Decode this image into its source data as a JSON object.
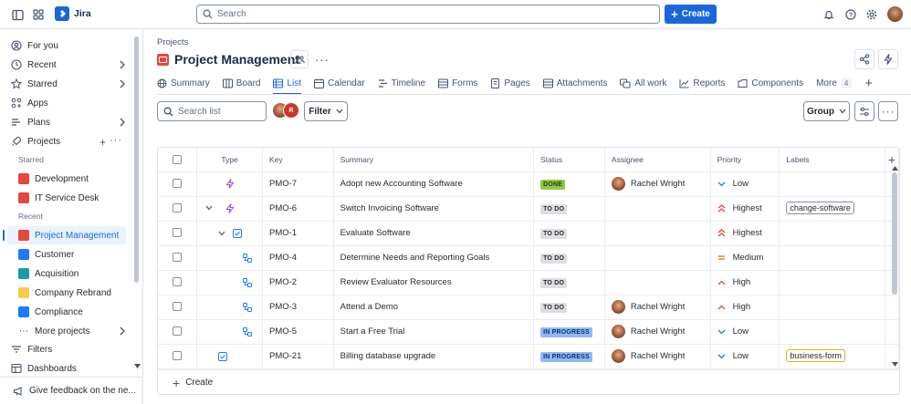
{
  "topbar": {
    "app_name": "Jira",
    "search_placeholder": "Search",
    "create_label": "Create"
  },
  "sidebar": {
    "nav": [
      {
        "label": "For you"
      },
      {
        "label": "Recent"
      },
      {
        "label": "Starred"
      },
      {
        "label": "Apps"
      },
      {
        "label": "Plans"
      },
      {
        "label": "Projects"
      }
    ],
    "starred_heading": "Starred",
    "starred": [
      {
        "label": "Development",
        "color": "#e2483d"
      },
      {
        "label": "IT Service Desk",
        "color": "#e2483d"
      }
    ],
    "recent_heading": "Recent",
    "recent": [
      {
        "label": "Project Management",
        "color": "#e2483d"
      },
      {
        "label": "Customer",
        "color": "#1d7afc"
      },
      {
        "label": "Acquisition",
        "color": "#1d9aaa"
      },
      {
        "label": "Company Rebrand",
        "color": "#f5cd47"
      },
      {
        "label": "Compliance",
        "color": "#1d7afc"
      }
    ],
    "more_projects": "More projects",
    "filters": "Filters",
    "dashboards": "Dashboards",
    "feedback": "Give feedback on the ne..."
  },
  "header": {
    "breadcrumb": "Projects",
    "title": "Project Management"
  },
  "tabs": [
    {
      "label": "Summary"
    },
    {
      "label": "Board"
    },
    {
      "label": "List"
    },
    {
      "label": "Calendar"
    },
    {
      "label": "Timeline"
    },
    {
      "label": "Forms"
    },
    {
      "label": "Pages"
    },
    {
      "label": "Attachments"
    },
    {
      "label": "All work"
    },
    {
      "label": "Reports"
    },
    {
      "label": "Components"
    },
    {
      "label": "More",
      "count": "4"
    }
  ],
  "toolbar": {
    "search_placeholder": "Search list",
    "filter_label": "Filter",
    "group_label": "Group"
  },
  "table": {
    "columns": [
      "Type",
      "Key",
      "Summary",
      "Status",
      "Assignee",
      "Priority",
      "Labels"
    ],
    "rows": [
      {
        "key": "PMO-7",
        "summary": "Adopt new Accounting Software",
        "status": "DONE",
        "assignee": "Rachel Wright",
        "priority": "Low",
        "label": ""
      },
      {
        "key": "PMO-6",
        "summary": "Switch Invoicing Software",
        "status": "TO DO",
        "assignee": "",
        "priority": "Highest",
        "label": "change-software"
      },
      {
        "key": "PMO-1",
        "summary": "Evaluate Software",
        "status": "TO DO",
        "assignee": "",
        "priority": "Highest",
        "label": ""
      },
      {
        "key": "PMO-4",
        "summary": "Determine Needs and Reporting Goals",
        "status": "TO DO",
        "assignee": "",
        "priority": "Medium",
        "label": ""
      },
      {
        "key": "PMO-2",
        "summary": "Review Evaluator Resources",
        "status": "TO DO",
        "assignee": "",
        "priority": "High",
        "label": ""
      },
      {
        "key": "PMO-3",
        "summary": "Attend a Demo",
        "status": "TO DO",
        "assignee": "Rachel Wright",
        "priority": "High",
        "label": ""
      },
      {
        "key": "PMO-5",
        "summary": "Start a Free Trial",
        "status": "IN PROGRESS",
        "assignee": "Rachel Wright",
        "priority": "Low",
        "label": ""
      },
      {
        "key": "PMO-21",
        "summary": "Billing database upgrade",
        "status": "IN PROGRESS",
        "assignee": "Rachel Wright",
        "priority": "Low",
        "label": "business-form"
      }
    ]
  },
  "create_row_label": "Create"
}
